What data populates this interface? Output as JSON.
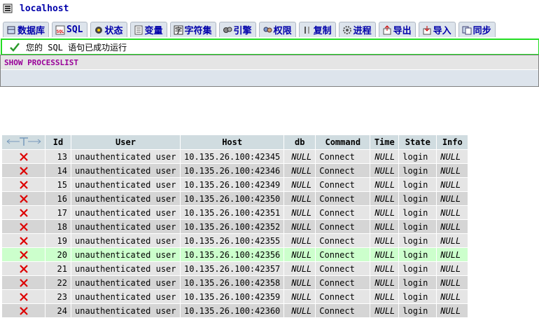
{
  "server": {
    "label": "localhost",
    "icon": "server-icon"
  },
  "tabs": [
    {
      "label": "数据库",
      "icon": "database-icon"
    },
    {
      "label": "SQL",
      "icon": "sql-icon"
    },
    {
      "label": "状态",
      "icon": "status-icon"
    },
    {
      "label": "变量",
      "icon": "variables-icon"
    },
    {
      "label": "字符集",
      "icon": "charset-icon"
    },
    {
      "label": "引擎",
      "icon": "engine-icon"
    },
    {
      "label": "权限",
      "icon": "privileges-icon"
    },
    {
      "label": "复制",
      "icon": "replication-icon"
    },
    {
      "label": "进程",
      "icon": "process-icon"
    },
    {
      "label": "导出",
      "icon": "export-icon"
    },
    {
      "label": "导入",
      "icon": "import-icon"
    },
    {
      "label": "同步",
      "icon": "sync-icon"
    }
  ],
  "message": {
    "text": "您的 SQL 语句已成功运行",
    "icon": "checkmark-icon"
  },
  "query": {
    "sql": "SHOW PROCESSLIST"
  },
  "table": {
    "headers": [
      "←T→",
      "Id",
      "User",
      "Host",
      "db",
      "Command",
      "Time",
      "State",
      "Info"
    ],
    "rows": [
      {
        "id": "13",
        "user": "unauthenticated user",
        "host": "10.135.26.100:42345",
        "db": "NULL",
        "command": "Connect",
        "time": "NULL",
        "state": "login",
        "info": "NULL"
      },
      {
        "id": "14",
        "user": "unauthenticated user",
        "host": "10.135.26.100:42346",
        "db": "NULL",
        "command": "Connect",
        "time": "NULL",
        "state": "login",
        "info": "NULL"
      },
      {
        "id": "15",
        "user": "unauthenticated user",
        "host": "10.135.26.100:42349",
        "db": "NULL",
        "command": "Connect",
        "time": "NULL",
        "state": "login",
        "info": "NULL"
      },
      {
        "id": "16",
        "user": "unauthenticated user",
        "host": "10.135.26.100:42350",
        "db": "NULL",
        "command": "Connect",
        "time": "NULL",
        "state": "login",
        "info": "NULL"
      },
      {
        "id": "17",
        "user": "unauthenticated user",
        "host": "10.135.26.100:42351",
        "db": "NULL",
        "command": "Connect",
        "time": "NULL",
        "state": "login",
        "info": "NULL"
      },
      {
        "id": "18",
        "user": "unauthenticated user",
        "host": "10.135.26.100:42352",
        "db": "NULL",
        "command": "Connect",
        "time": "NULL",
        "state": "login",
        "info": "NULL"
      },
      {
        "id": "19",
        "user": "unauthenticated user",
        "host": "10.135.26.100:42355",
        "db": "NULL",
        "command": "Connect",
        "time": "NULL",
        "state": "login",
        "info": "NULL"
      },
      {
        "id": "20",
        "user": "unauthenticated user",
        "host": "10.135.26.100:42356",
        "db": "NULL",
        "command": "Connect",
        "time": "NULL",
        "state": "login",
        "info": "NULL",
        "highlight": true
      },
      {
        "id": "21",
        "user": "unauthenticated user",
        "host": "10.135.26.100:42357",
        "db": "NULL",
        "command": "Connect",
        "time": "NULL",
        "state": "login",
        "info": "NULL"
      },
      {
        "id": "22",
        "user": "unauthenticated user",
        "host": "10.135.26.100:42358",
        "db": "NULL",
        "command": "Connect",
        "time": "NULL",
        "state": "login",
        "info": "NULL"
      },
      {
        "id": "23",
        "user": "unauthenticated user",
        "host": "10.135.26.100:42359",
        "db": "NULL",
        "command": "Connect",
        "time": "NULL",
        "state": "login",
        "info": "NULL"
      },
      {
        "id": "24",
        "user": "unauthenticated user",
        "host": "10.135.26.100:42360",
        "db": "NULL",
        "command": "Connect",
        "time": "NULL",
        "state": "login",
        "info": "NULL"
      }
    ]
  },
  "colors": {
    "link": "#0000aa",
    "success_border": "#22dd22",
    "sql_keyword": "#990099",
    "kill_x": "#dd0000",
    "highlight_row": "#ccffcc"
  }
}
